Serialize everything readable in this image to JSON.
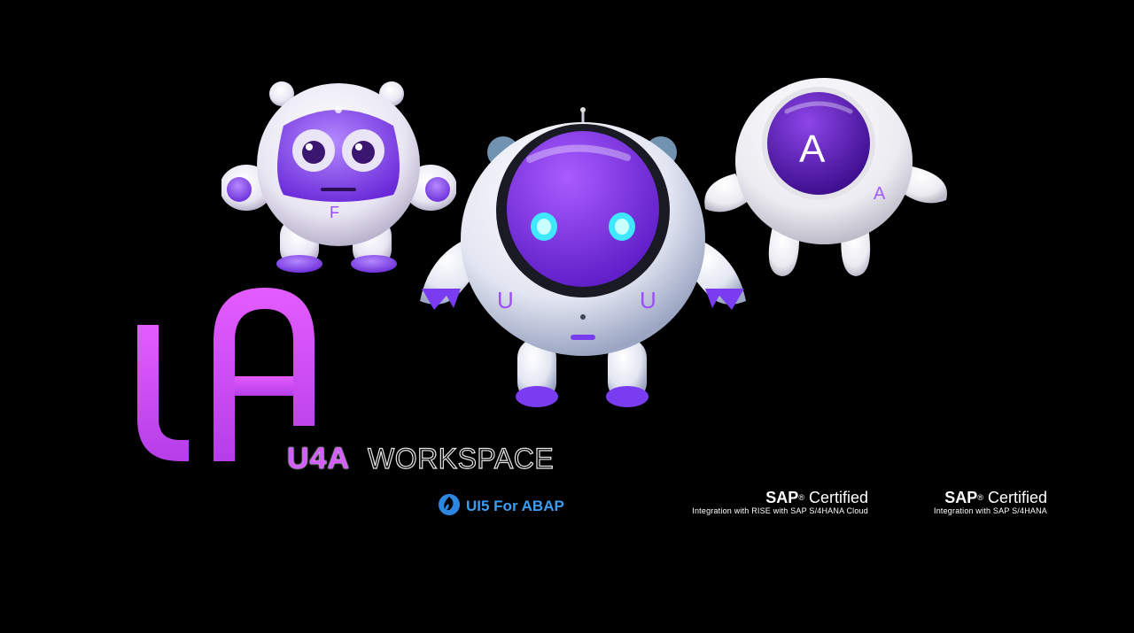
{
  "mascots": {
    "f_label": "F",
    "u_label_left": "U",
    "u_label_right": "U",
    "a_big_label": "A",
    "a_small_label": "A"
  },
  "brand": {
    "name": "U4A",
    "product": "WORKSPACE"
  },
  "badges": {
    "ui5": "UI5 For ABAP",
    "sap_cert_1": {
      "brand": "SAP",
      "reg": "®",
      "title": "Certified",
      "subtitle": "Integration with RISE with SAP S/4HANA Cloud"
    },
    "sap_cert_2": {
      "brand": "SAP",
      "reg": "®",
      "title": "Certified",
      "subtitle": "Integration with SAP S/4HANA"
    }
  },
  "colors": {
    "background": "#000000",
    "brand_purple": "#c642f5",
    "mascot_purple": "#7b2ff2",
    "ui5_blue": "#3b9cf0"
  }
}
